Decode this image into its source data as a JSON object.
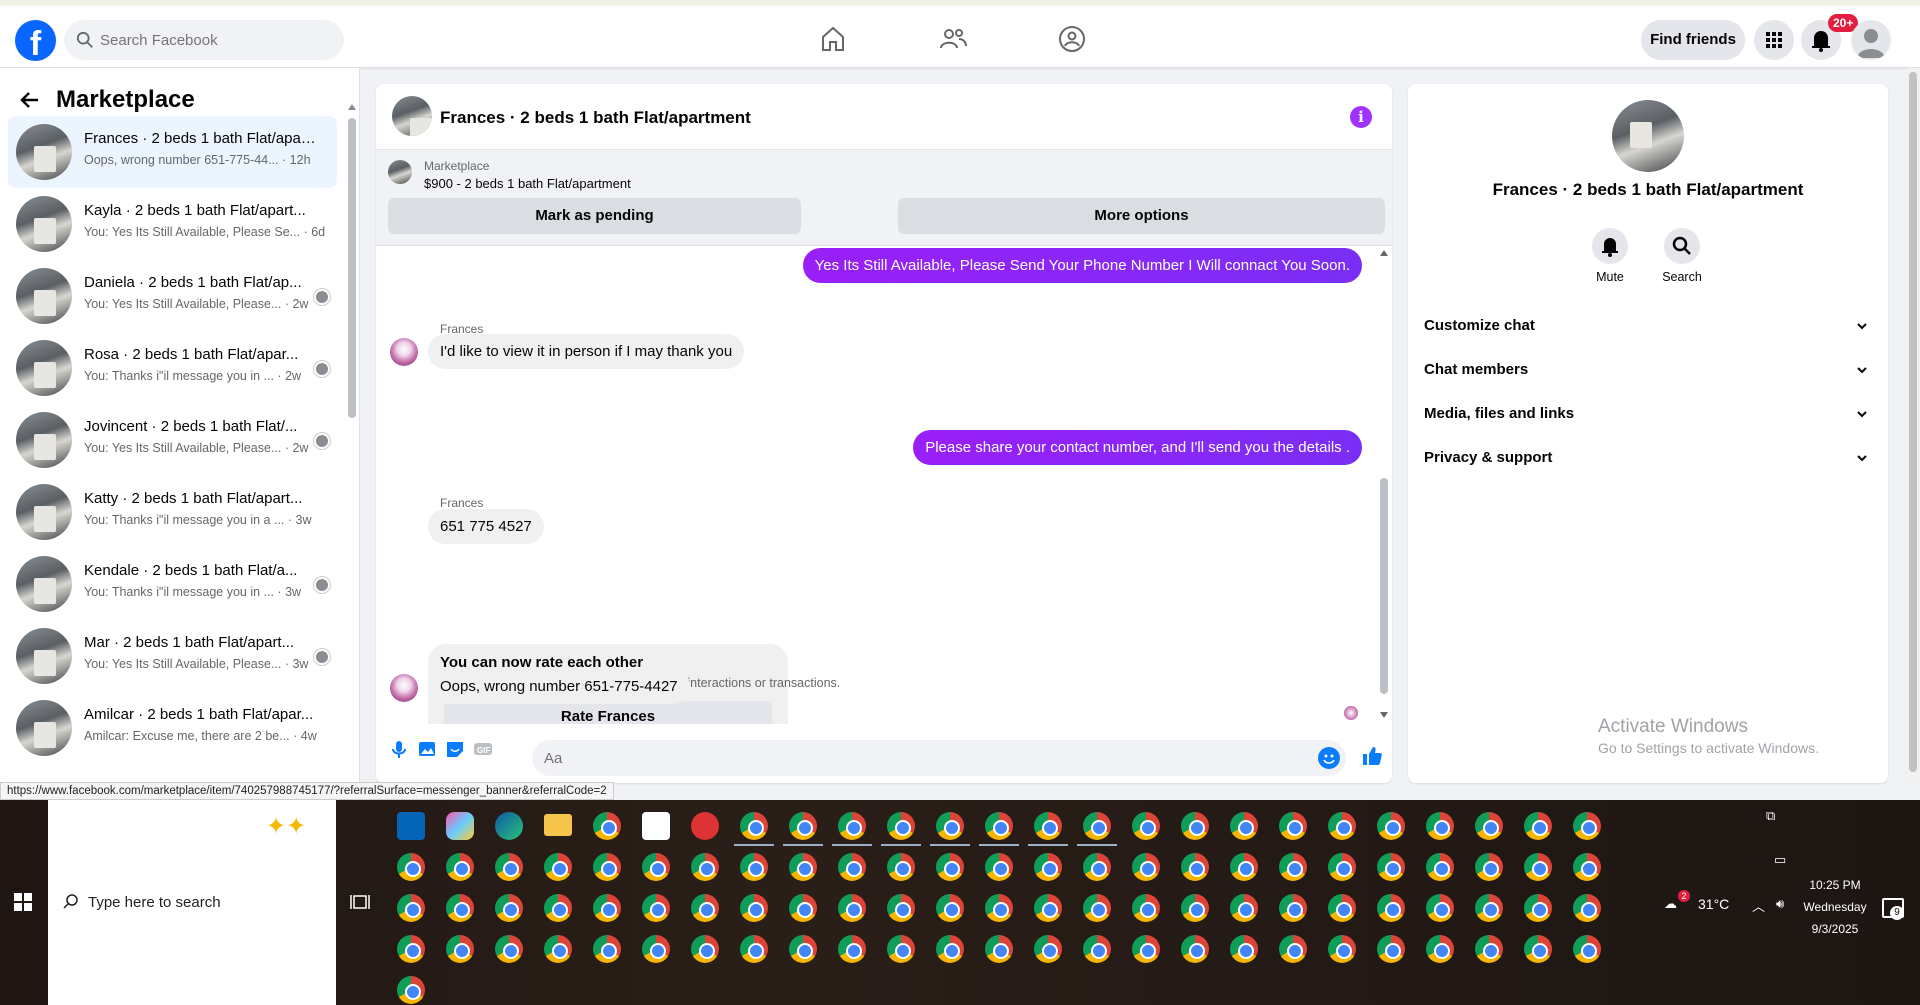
{
  "topnav": {
    "search_placeholder": "Search Facebook",
    "find_friends": "Find friends",
    "notif_badge": "20+"
  },
  "sidebar": {
    "title": "Marketplace",
    "conversations": [
      {
        "name": "Frances · 2 beds 1 bath Flat/apar...",
        "preview": "Oops, wrong number 651-775-44... · 12h",
        "active": true
      },
      {
        "name": "Kayla · 2 beds 1 bath Flat/apart...",
        "preview": "You: Yes Its Still Available, Please Se... · 6d"
      },
      {
        "name": "Daniela · 2 beds 1 bath Flat/ap...",
        "preview": "You: Yes Its Still Available, Please... · 2w"
      },
      {
        "name": "Rosa · 2 beds 1 bath Flat/apar...",
        "preview": "You: Thanks i\"il message you in ... · 2w"
      },
      {
        "name": "Jovincent · 2 beds 1 bath Flat/...",
        "preview": "You: Yes Its Still Available, Please... · 2w"
      },
      {
        "name": "Katty · 2 beds 1 bath Flat/apart...",
        "preview": "You: Thanks i\"il message you in a ... · 3w"
      },
      {
        "name": "Kendale · 2 beds 1 bath Flat/a...",
        "preview": "You: Thanks i\"il message you in ... · 3w"
      },
      {
        "name": "Mar · 2 beds 1 bath Flat/apart...",
        "preview": "You: Yes Its Still Available, Please... · 3w"
      },
      {
        "name": "Amilcar · 2 beds 1 bath Flat/apar...",
        "preview": "Amilcar: Excuse me, there are 2 be... · 4w"
      }
    ]
  },
  "chat": {
    "title": "Frances · 2 beds 1 bath Flat/apartment",
    "banner_label": "Marketplace",
    "banner_price": "$900 - 2 beds 1 bath Flat/apartment",
    "btn_pending": "Mark as pending",
    "btn_more": "More options",
    "msg_out_1": "Yes Its Still Available, Please Send Your Phone Number I Will connact You Soon.",
    "sender_1": "Frances",
    "msg_in_1": "I'd like to view it in person if I may thank you",
    "msg_out_2": "Please share your contact number, and I'll send you the details .",
    "sender_2": "Frances",
    "msg_in_2": "651 775 4527",
    "rate_title": "You can now rate each other",
    "rate_sub": "People may rate one another based on their interactions or transactions.",
    "rate_btn": "Rate Frances",
    "msg_in_3": "Oops, wrong number 651-775-4427",
    "composer_placeholder": "Aa"
  },
  "rpanel": {
    "title": "Frances · 2 beds 1 bath Flat/apartment",
    "mute": "Mute",
    "search": "Search",
    "rows": [
      "Customize chat",
      "Chat members",
      "Media, files and links",
      "Privacy & support"
    ],
    "activate_1": "Activate Windows",
    "activate_2": "Go to Settings to activate Windows."
  },
  "status_url": "https://www.facebook.com/marketplace/item/740257988745177/?referralSurface=messenger_banner&referralCode=2",
  "taskbar": {
    "search_text": "Type here to search",
    "temperature": "31°C",
    "time": "10:25 PM",
    "day": "Wednesday",
    "date": "9/3/2025",
    "notif_count": "9",
    "weather_badge": "2"
  }
}
